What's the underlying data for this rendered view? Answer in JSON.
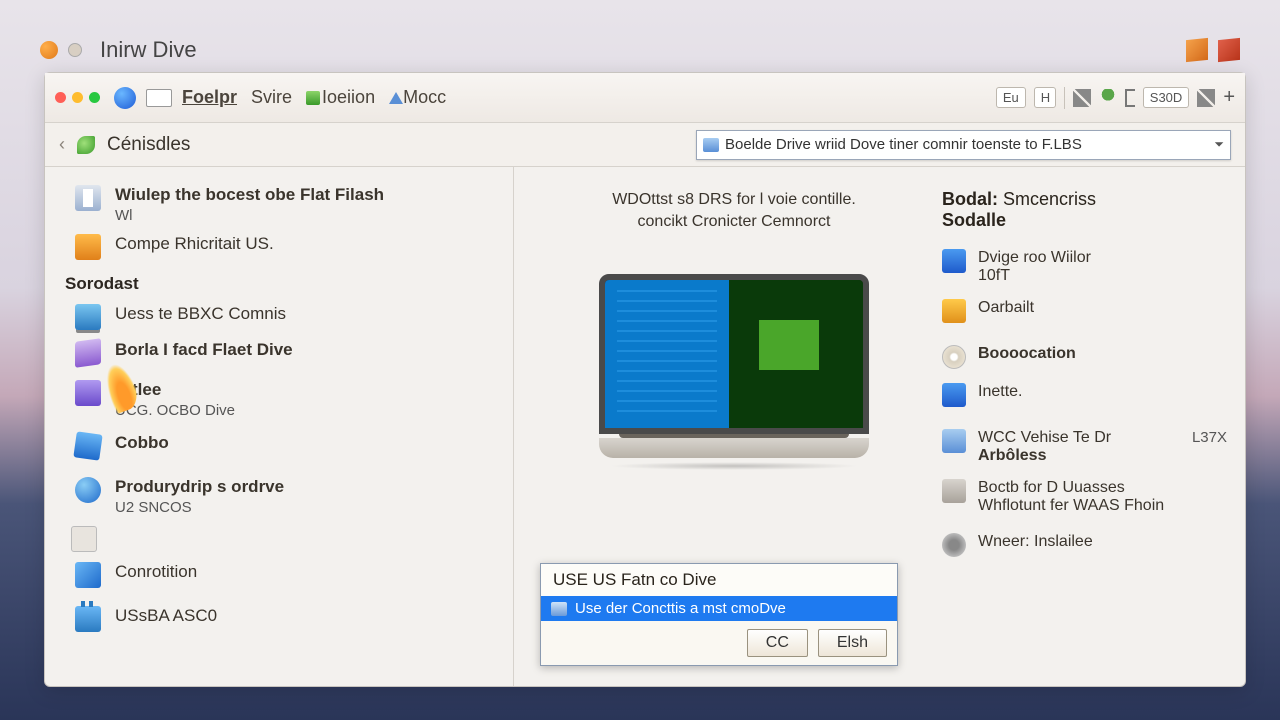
{
  "titlebar": {
    "title": "Inirw Dive"
  },
  "menu": {
    "items": [
      "Foelpr",
      "Svire",
      "Ioeiion",
      "Mocc"
    ]
  },
  "toolbar_right": {
    "chip1": "Eu",
    "chip2": "H",
    "readout": "S30D"
  },
  "breadcrumb": {
    "label": "Cénisdles",
    "address": "Boelde Drive wriid Dove tiner comnir toenste to F.LBS"
  },
  "sidebar": {
    "top": [
      {
        "title": "Wiulep the bocest obe Flat Filash",
        "sub": "Wl"
      },
      {
        "title": "Compe Rhicritait US."
      }
    ],
    "heading": "Sorodast",
    "items": [
      {
        "title": "Uess te BBXC Comnis"
      },
      {
        "title": "Borla I facd Flaet Dive"
      },
      {
        "title": "Nitlee",
        "sub": "UCG. OCBO Dive"
      },
      {
        "title": "Cobbo"
      },
      {
        "title": "Produrydrip s ordrve",
        "sub": "U2 SNCOS"
      },
      {
        "title": "Conrotition"
      },
      {
        "title": "USsBA ASC0"
      }
    ]
  },
  "center": {
    "line1": "WDOttst s8 DRS for l voie contille.",
    "line2": "concikt Cronicter Cemnorct"
  },
  "dialog": {
    "title": "USE US Fatn co Dive",
    "selected": "Use der Concttis a mst cmoDve",
    "btn_ok": "CC",
    "btn_cancel": "Elsh"
  },
  "rightcol": {
    "heading_a": "Bodal:",
    "heading_b": "Smcencriss",
    "heading_c": "Sodalle",
    "items": [
      {
        "t1": "Dvige roo Wiilor",
        "t2": "10fT"
      },
      {
        "t1": "Oarbailt"
      },
      {
        "t1": "Boooocation",
        "bold": true
      },
      {
        "t1": "Inette."
      },
      {
        "t1": "WCC Vehise Te Dr",
        "t2": "Arbôless",
        "meta": "L37X"
      },
      {
        "t1": "Boctb for D Uuasses",
        "t2": "Whflotunt fer WAAS Fhoin"
      },
      {
        "t1": "Wneer: Inslailee"
      }
    ]
  }
}
